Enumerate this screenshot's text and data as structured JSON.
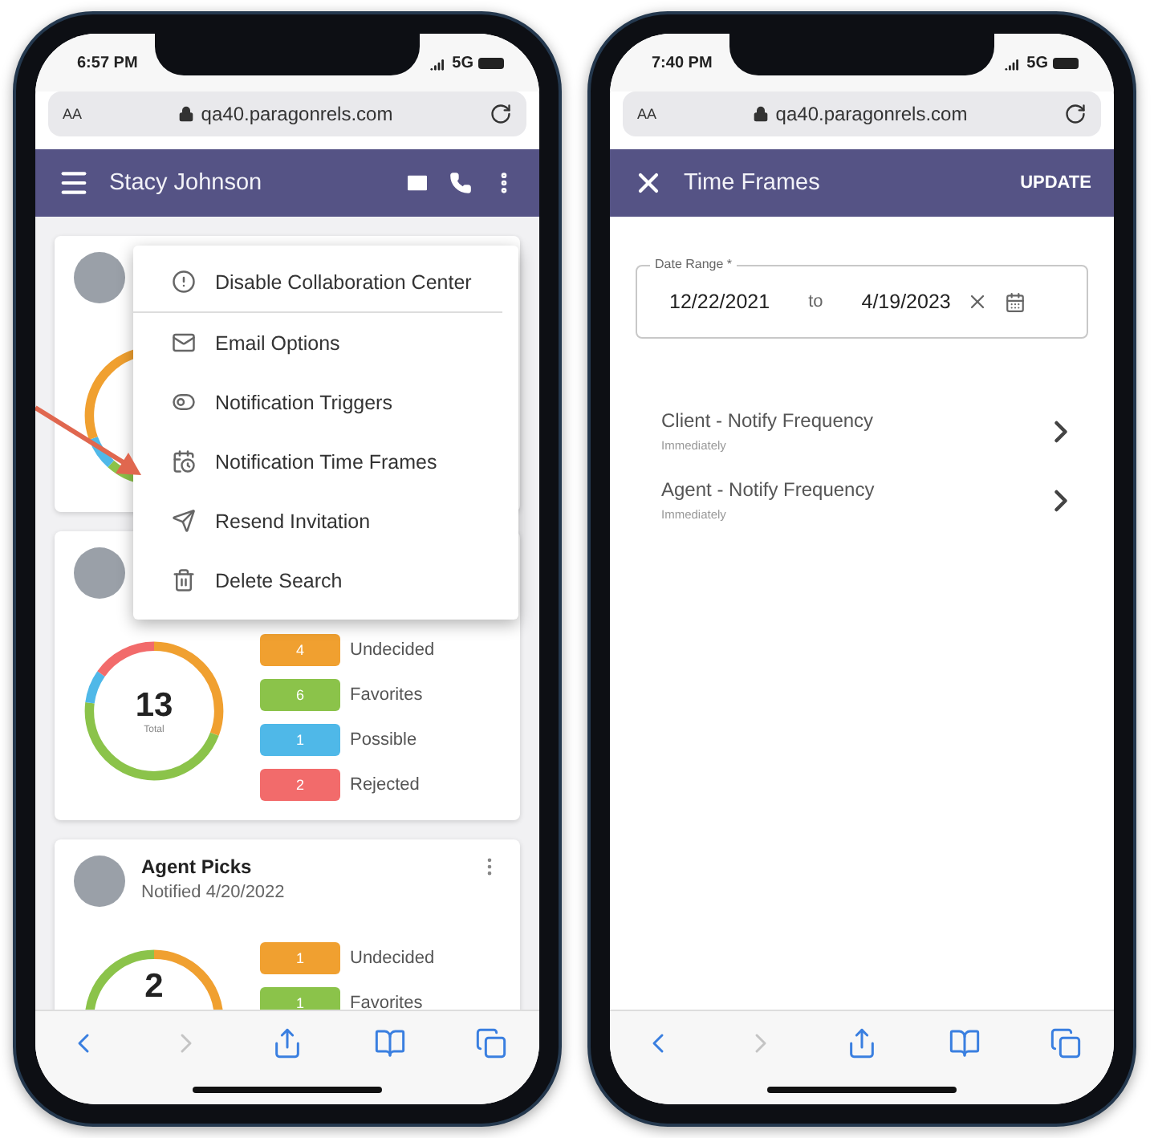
{
  "phones": [
    {
      "status": {
        "time": "6:57 PM",
        "network": "5G"
      },
      "browser": {
        "text_size": "AA",
        "url": "qa40.paragonrels.com"
      },
      "app_bar": {
        "kind": "contact",
        "title": "Stacy Johnson"
      },
      "cards": [
        {
          "kind": "covered"
        },
        {
          "kind": "full",
          "total": "13",
          "total_label": "Total",
          "legend": [
            {
              "count": "4",
              "label": "Undecided",
              "color": "#f0a030"
            },
            {
              "count": "6",
              "label": "Favorites",
              "color": "#8bc34a"
            },
            {
              "count": "1",
              "label": "Possible",
              "color": "#4fb8e8"
            },
            {
              "count": "2",
              "label": "Rejected",
              "color": "#f26b6b"
            }
          ]
        },
        {
          "kind": "clipped",
          "title": "Agent Picks",
          "subtitle": "Notified 4/20/2022",
          "total": "2",
          "legend": [
            {
              "count": "1",
              "label": "Undecided",
              "color": "#f0a030"
            },
            {
              "count": "1",
              "label": "Favorites",
              "color": "#8bc34a"
            }
          ]
        }
      ],
      "menu": {
        "items": [
          {
            "label": "Disable Collaboration Center",
            "divider_after": true
          },
          {
            "label": "Email Options",
            "divider_after": false
          },
          {
            "label": "Notification Triggers",
            "divider_after": false
          },
          {
            "label": "Notification Time Frames",
            "divider_after": false
          },
          {
            "label": "Resend Invitation",
            "divider_after": false
          },
          {
            "label": "Delete Search",
            "divider_after": false
          }
        ]
      },
      "annotation": {
        "kind": "arrow"
      },
      "toolbar": [
        {
          "kind": "back",
          "disabled": false
        },
        {
          "kind": "forward",
          "disabled": true
        },
        {
          "kind": "share",
          "disabled": false
        },
        {
          "kind": "bookmarks",
          "disabled": false
        },
        {
          "kind": "tabs",
          "disabled": false
        }
      ]
    },
    {
      "status": {
        "time": "7:40 PM",
        "network": "5G"
      },
      "browser": {
        "text_size": "AA",
        "url": "qa40.paragonrels.com"
      },
      "app_bar": {
        "kind": "close",
        "title": "Time Frames",
        "action": "UPDATE"
      },
      "date_range": {
        "label": "Date Range *",
        "from": "12/22/2021",
        "separator": "to",
        "to": "4/19/2023"
      },
      "settings": [
        {
          "title": "Client - Notify Frequency",
          "subtitle": "Immediately"
        },
        {
          "title": "Agent - Notify Frequency",
          "subtitle": "Immediately"
        }
      ],
      "toolbar": [
        {
          "kind": "back",
          "disabled": false
        },
        {
          "kind": "forward",
          "disabled": true
        },
        {
          "kind": "share",
          "disabled": false
        },
        {
          "kind": "bookmarks",
          "disabled": false
        },
        {
          "kind": "tabs",
          "disabled": false
        }
      ]
    }
  ]
}
